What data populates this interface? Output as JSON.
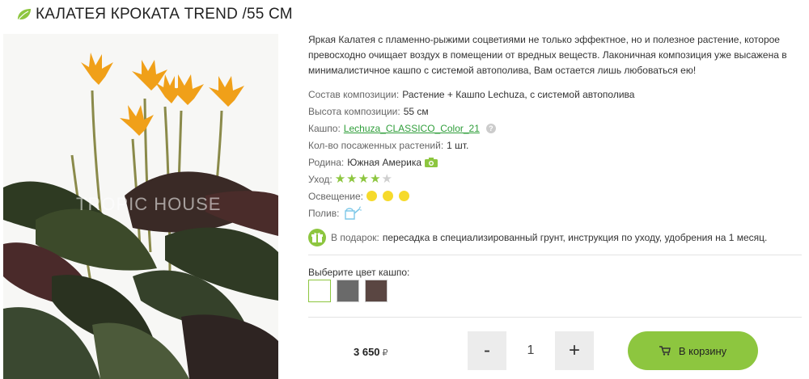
{
  "product": {
    "title": "КАЛАТЕЯ КРОКАТА TREND /55 СМ",
    "leaf_icon": "leaf-icon",
    "watermark": "TROPIC HOUSE",
    "description": "Яркая Калатея с пламенно-рыжими соцветиями не только эффектное, но и полезное растение, которое превосходно очищает воздух в помещении от вредных веществ. Лаконичная композиция уже высажена в минималистичное кашпо с системой автополива, Вам остается лишь любоваться ею!"
  },
  "props": {
    "composition": {
      "label": "Состав композиции:",
      "value": "Растение + Кашпо Lechuza, с системой автополива"
    },
    "height": {
      "label": "Высота композиции:",
      "value": "55 см"
    },
    "pot": {
      "label": "Кашпо:",
      "value": "Lechuza_CLASSICO_Color_21",
      "help": "?"
    },
    "count": {
      "label": "Кол-во посаженных растений:",
      "value": "1 шт."
    },
    "origin": {
      "label": "Родина:",
      "value": "Южная Америка",
      "icon": "camera-icon"
    },
    "care": {
      "label": "Уход:",
      "rating": 4,
      "max": 5
    },
    "light": {
      "label": "Освещение:",
      "level": 3
    },
    "water": {
      "label": "Полив:",
      "icon": "watering-can-icon"
    }
  },
  "gift": {
    "label": "В подарок:",
    "text": "пересадка в специализированный грунт, инструкция по уходу, удобрения на 1 месяц.",
    "icon": "gift-icon"
  },
  "colors": {
    "title": "Выберите цвет кашпо:",
    "options": [
      {
        "name": "white",
        "hex": "#ffffff",
        "selected": true
      },
      {
        "name": "graphite",
        "hex": "#6a6a6a",
        "selected": false
      },
      {
        "name": "brown",
        "hex": "#5a4642",
        "selected": false
      }
    ]
  },
  "purchase": {
    "price": "3 650",
    "currency": "₽",
    "minus": "-",
    "plus": "+",
    "quantity": "1",
    "cart_label": "В корзину",
    "cart_icon": "cart-icon"
  },
  "theme": {
    "accent": "#8dc63f",
    "link": "#2f9e3a",
    "stars_on": "#8dc63f",
    "sun": "#f6da2b"
  }
}
